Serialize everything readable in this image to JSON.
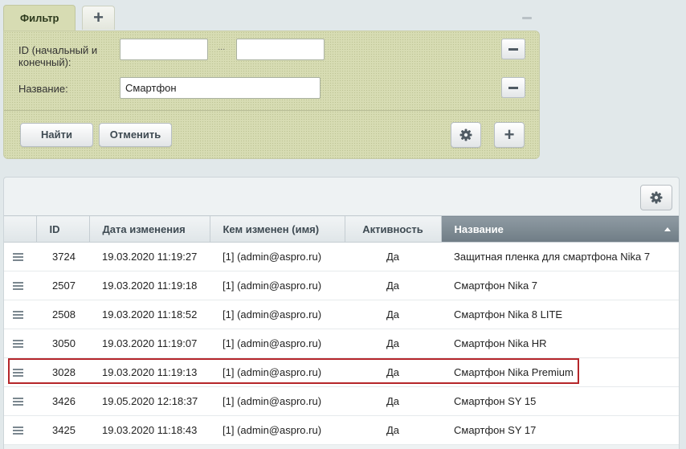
{
  "filter": {
    "tab_label": "Фильтр",
    "add_tab_label": "+",
    "fields": {
      "id_label_line1": "ID (начальный и",
      "id_label_line2": "конечный):",
      "id_from_value": "",
      "id_range_sep": "...",
      "id_to_value": "",
      "name_label": "Название:",
      "name_value": "Смартфон"
    },
    "find_button": "Найти",
    "cancel_button": "Отменить",
    "add_field_button": "+"
  },
  "grid": {
    "columns": {
      "id": "ID",
      "date": "Дата изменения",
      "modified_by": "Кем изменен (имя)",
      "active": "Активность",
      "name": "Название"
    },
    "sorted_column": "name",
    "sort_direction": "asc",
    "rows": [
      {
        "id": "3724",
        "date": "19.03.2020 11:19:27",
        "modified_by": "[1] (admin@aspro.ru)",
        "active": "Да",
        "name": "Защитная пленка для смартфона Nika 7"
      },
      {
        "id": "2507",
        "date": "19.03.2020 11:19:18",
        "modified_by": "[1] (admin@aspro.ru)",
        "active": "Да",
        "name": "Смартфон Nika 7"
      },
      {
        "id": "2508",
        "date": "19.03.2020 11:18:52",
        "modified_by": "[1] (admin@aspro.ru)",
        "active": "Да",
        "name": "Смартфон Nika 8 LITE"
      },
      {
        "id": "3050",
        "date": "19.03.2020 11:19:07",
        "modified_by": "[1] (admin@aspro.ru)",
        "active": "Да",
        "name": "Смартфон Nika HR"
      },
      {
        "id": "3028",
        "date": "19.03.2020 11:19:13",
        "modified_by": "[1] (admin@aspro.ru)",
        "active": "Да",
        "name": "Смартфон Nika Premium"
      },
      {
        "id": "3426",
        "date": "19.05.2020 12:18:37",
        "modified_by": "[1] (admin@aspro.ru)",
        "active": "Да",
        "name": "Смартфон SY 15"
      },
      {
        "id": "3425",
        "date": "19.03.2020 11:18:43",
        "modified_by": "[1] (admin@aspro.ru)",
        "active": "Да",
        "name": "Смартфон SY 17"
      }
    ],
    "highlighted_row_index": 4
  },
  "colors": {
    "filter_bg": "#d7dcb3",
    "sorted_header": "#7d8a93",
    "highlight_border": "#b5262a"
  },
  "icons": {
    "add_tab": "plus-icon",
    "collapse": "minus-icon",
    "remove_field": "minus-icon",
    "filter_settings": "gear-icon",
    "add_field": "plus-icon",
    "grid_settings": "gear-icon",
    "row_menu": "hamburger-icon",
    "sort": "sort-asc-icon"
  }
}
